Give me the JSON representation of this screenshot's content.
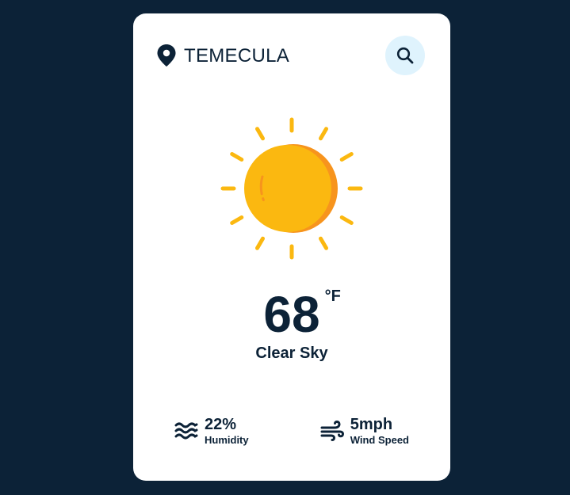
{
  "location": {
    "city": "TEMECULA",
    "icon": "map-pin-icon"
  },
  "search": {
    "icon": "search-icon"
  },
  "weather": {
    "icon": "sun-icon",
    "temperature": "68",
    "unit": "°F",
    "condition": "Clear Sky"
  },
  "details": {
    "humidity": {
      "value": "22%",
      "label": "Humidity",
      "icon": "humidity-waves-icon"
    },
    "wind": {
      "value": "5mph",
      "label": "Wind Speed",
      "icon": "wind-icon"
    }
  },
  "colors": {
    "background": "#0c2237",
    "card": "#ffffff",
    "text": "#0c2237",
    "search_button": "#dff3fd",
    "sun_main": "#fbb810",
    "sun_shade": "#f7941d",
    "sun_rays": "#fbb810"
  }
}
